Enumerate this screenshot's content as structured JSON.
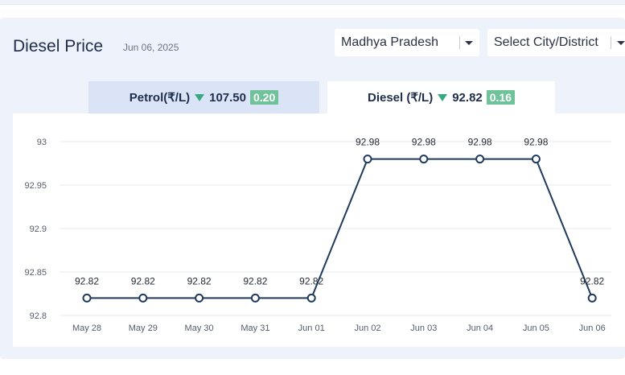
{
  "header": {
    "title": "Diesel Price",
    "date": "Jun 06, 2025"
  },
  "filters": {
    "state_value": "Madhya Pradesh",
    "city_placeholder": "Select City/District"
  },
  "tabs": {
    "petrol": {
      "label": "Petrol(₹/L)",
      "price": "107.50",
      "change": "0.20",
      "trend": "down"
    },
    "diesel": {
      "label": "Diesel (₹/L)",
      "price": "92.82",
      "change": "0.16",
      "trend": "down",
      "selected": true
    }
  },
  "colors": {
    "line": "#1f3a5c",
    "badge": "#6fc299",
    "trend_down": "#37a981",
    "panel_bg": "#eef2fb"
  },
  "chart_data": {
    "type": "line",
    "categories": [
      "May 28",
      "May 29",
      "May 30",
      "May 31",
      "Jun 01",
      "Jun 02",
      "Jun 03",
      "Jun 04",
      "Jun 05",
      "Jun 06"
    ],
    "values": [
      92.82,
      92.82,
      92.82,
      92.82,
      92.82,
      92.98,
      92.98,
      92.98,
      92.98,
      92.82
    ],
    "data_labels": [
      "92.82",
      "92.82",
      "92.82",
      "92.82",
      "92.82",
      "92.98",
      "92.98",
      "92.98",
      "92.98",
      "92.82"
    ],
    "yticks": [
      "92.8",
      "92.85",
      "92.9",
      "92.95",
      "93"
    ],
    "ylim": [
      92.8,
      93
    ],
    "grid": true,
    "title": "",
    "xlabel": "",
    "ylabel": ""
  }
}
